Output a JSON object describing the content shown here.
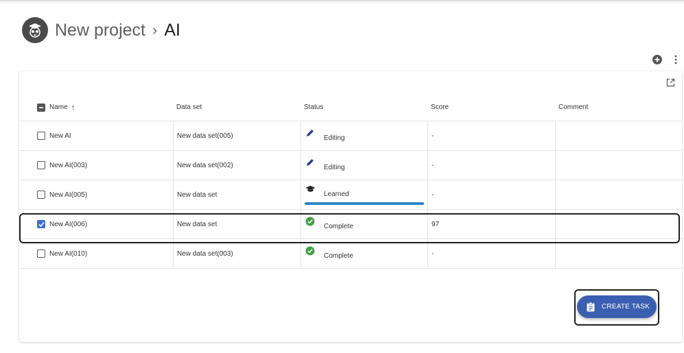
{
  "breadcrumb": {
    "project": "New project",
    "separator": "›",
    "current": "AI"
  },
  "colors": {
    "accent": "#3b5fb0",
    "checkbox_checked": "#3a6fd8",
    "complete": "#43a047",
    "editing": "#2f3f8f",
    "progress": "#2f86c8"
  },
  "icons": {
    "logo": "owl-logo-icon",
    "add": "add-circle-icon",
    "more": "more-vert-icon",
    "open_external": "open-in-new-icon",
    "sort": "arrow-up-icon",
    "create_task": "clipboard-icon"
  },
  "table": {
    "headers": {
      "name": "Name",
      "sort_indicator": "↑",
      "data_set": "Data set",
      "status": "Status",
      "score": "Score",
      "comment": "Comment"
    },
    "rows": [
      {
        "checked": false,
        "name": "New AI",
        "data_set": "New data set(005)",
        "status": "Editing",
        "status_icon": "pencil-icon",
        "score": "-",
        "comment": ""
      },
      {
        "checked": false,
        "name": "New AI(003)",
        "data_set": "New data set(002)",
        "status": "Editing",
        "status_icon": "pencil-icon",
        "score": "-",
        "comment": ""
      },
      {
        "checked": false,
        "name": "New AI(005)",
        "data_set": "New data set",
        "status": "Learned",
        "status_icon": "graduation-cap-icon",
        "score": "-",
        "comment": "",
        "progress": 1.0
      },
      {
        "checked": true,
        "name": "New AI(006)",
        "data_set": "New data set",
        "status": "Complete",
        "status_icon": "check-circle-icon",
        "score": "97",
        "comment": ""
      },
      {
        "checked": false,
        "name": "New AI(010)",
        "data_set": "New data set(003)",
        "status": "Complete",
        "status_icon": "check-circle-icon",
        "score": "-",
        "comment": ""
      }
    ]
  },
  "actions": {
    "create_task_label": "CREATE TASK"
  }
}
